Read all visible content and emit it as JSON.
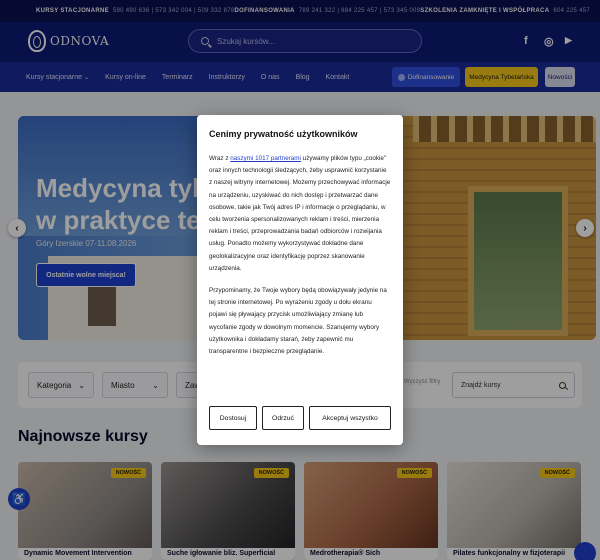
{
  "topbar": {
    "segments": [
      {
        "label": "KURSY STACJONARNE",
        "phones": "590 490 636 | 573 342 004 | 509 332 878"
      },
      {
        "label": "DOFINANSOWANIA",
        "phones": "789 241 322 | 884 225 457 | 573 345 009"
      },
      {
        "label": "SZKOLENIA ZAMKNIĘTE I WSPÓŁPRACA",
        "phones": "604 225 457"
      }
    ]
  },
  "header": {
    "logo_text": "ODNOVA",
    "search_placeholder": "Szukaj kursów...",
    "social": {
      "facebook": "f",
      "instagram": "◎",
      "youtube": "▶"
    }
  },
  "nav": {
    "items": [
      "Kursy stacjonarne",
      "Kursy on-line",
      "Terminarz",
      "Instruktorzy",
      "O nas",
      "Blog",
      "Kontakt"
    ],
    "btn_dofinansowanie": "Dofinansowanie",
    "btn_medycyna": "Medycyna Tybetańska",
    "btn_nowosci": "Nowości"
  },
  "hero": {
    "title_line1": "Medycyna tybe",
    "title_line2": "w praktyce tera",
    "subtitle": "Góry Izerskie 07-11.08.2026",
    "cta": "Ostatnie wolne miejsca!",
    "prev": "‹",
    "next": "›"
  },
  "filters": {
    "kategoria": "Kategoria",
    "miasto": "Miasto",
    "third": "Zaw",
    "clear": "Wyczyść filtry",
    "search": "Znajdź kursy"
  },
  "section_title": "Najnowsze kursy",
  "cards": [
    {
      "badge": "NOWOŚĆ",
      "title": "Dynamic Movement Intervention",
      "color": "#8f8a86"
    },
    {
      "badge": "NOWOŚĆ",
      "title": "Suche igłowanie bliz. Superficial",
      "color": "#4c4a4c"
    },
    {
      "badge": "NOWOŚĆ",
      "title": "Medrotherapia® Sich",
      "color": "#a86444"
    },
    {
      "badge": "NOWOŚĆ",
      "title": "Pilates funkcjonalny w fizjoterapii",
      "color": "#b9b4ac"
    }
  ],
  "modal": {
    "title": "Cenimy prywatność użytkowników",
    "p1_pre": "Wraz z ",
    "p1_link": "naszymi 1017 partnerami",
    "p1_post": " używamy plików typu „cookie\" oraz innych technologii śledzących, żeby usprawnić korzystanie z naszej witryny internetowej. Możemy przechowywać informacje na urządzeniu, uzyskiwać do nich dostęp i przetwarzać dane osobowe, takie jak Twój adres IP i informacje o przeglądaniu, w celu tworzenia spersonalizowanych reklam i treści, mierzenia reklam i treści, przeprowadzania badań odbiorców i rozwijania usług. Ponadto możemy wykorzystywać dokładne dane geolokalizacyjne oraz identyfikację poprzez skanowanie urządzenia.",
    "p2": "Przypominamy, że Twoje wybory będą obowiązywały jedynie na tej stronie internetowej. Po wyrażeniu zgody u dołu ekranu pojawi się pływający przycisk umożliwiający zmianę lub wycofanie zgody w dowolnym momencie. Szanujemy wybory użytkownika i dokładamy starań, żeby zapewnić mu transparentne i bezpieczne przeglądanie.",
    "btn_customize": "Dostosuj",
    "btn_reject": "Odrzuć",
    "btn_accept": "Akceptuj wszystko"
  },
  "colors": {
    "navy": "#0e1a78",
    "nav_blue": "#1a2a9a",
    "accent_blue": "#2f4fe0",
    "yellow": "#f6c81b"
  }
}
